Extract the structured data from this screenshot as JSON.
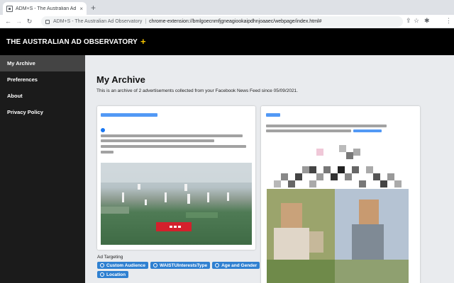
{
  "browser": {
    "tab_title": "ADM+S - The Australian Ad Ob",
    "tab_close": "×",
    "new_tab": "+",
    "back": "←",
    "forward": "→",
    "reload": "↻",
    "omnibox_label": "ADM+S - The Australian Ad Observatory",
    "omnibox_sep": "|",
    "url": "chrome-extension://bmlgoecnmfjgneagiookaipdhnjoaaec/webpage/index.html#",
    "share": "⇪",
    "bookmark": "☆",
    "extensions": "✱",
    "menu": "⋮"
  },
  "header": {
    "title": "THE AUSTRALIAN AD OBSERVATORY",
    "plus": "+"
  },
  "sidebar": {
    "items": [
      {
        "label": "My Archive"
      },
      {
        "label": "Preferences"
      },
      {
        "label": "About"
      },
      {
        "label": "Privacy Policy"
      }
    ]
  },
  "main": {
    "title": "My Archive",
    "description": "This is an archive of 2 advertisements collected from your Facebook News Feed since 05/09/2021."
  },
  "targeting": {
    "label": "Ad Targeting",
    "chips": [
      {
        "label": "Custom Audience"
      },
      {
        "label": "WAISTUInterestsType"
      },
      {
        "label": "Age and Gender"
      },
      {
        "label": "Location"
      }
    ]
  },
  "colors": {
    "header_bg": "#000000",
    "accent_plus": "#f7c600",
    "sidebar_bg": "#1b1b1b",
    "sidebar_active": "#444444",
    "chip_blue": "#2f80d1",
    "link_blue": "#1877f2"
  }
}
